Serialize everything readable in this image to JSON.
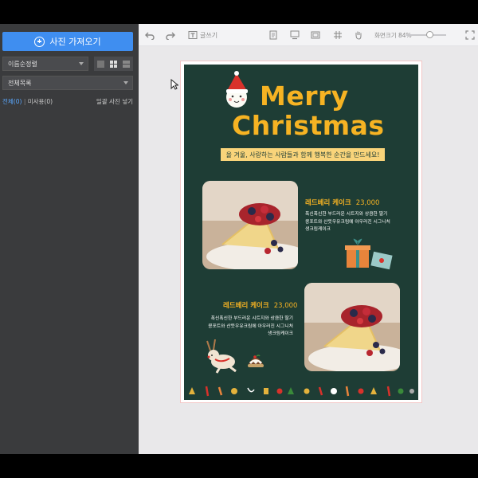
{
  "sidebar": {
    "import_label": "사진 가져오기",
    "sort_value": "이름순정렬",
    "folder_value": "전체목록",
    "filter_all": "전체(0)",
    "filter_unused": "미사용(0)",
    "bulk_insert": "일괄 사진 넣기"
  },
  "toolbar": {
    "text_tool_label": "글쓰기",
    "zoom_label": "화면크기 84%"
  },
  "poster": {
    "title_line1": "Merry",
    "title_line2": "Christmas",
    "banner": "올 겨울, 사랑하는 사람들과 함께 행복한 순간을 만드세요!",
    "product1": {
      "name": "레드베리 케이크",
      "price": "23,000",
      "desc": [
        "폭신폭신한 부드러운 시트지와 상큼한 딸기",
        "콩포트와 산뜻우유크림에 아우러진 시그니처",
        "생크림케이크"
      ]
    },
    "product2": {
      "name": "레드베리 케이크",
      "price": "23,000",
      "desc": [
        "폭신폭신한 부드러운 시트지와 상큼한 딸기",
        "콩포트와 산뜻우유크림에 아우러진 시그니처",
        "생크림케이크"
      ]
    }
  },
  "colors": {
    "accent": "#3f8ef0",
    "poster_bg": "#1e3d35",
    "title": "#f6b323",
    "banner": "#f9d47a"
  }
}
